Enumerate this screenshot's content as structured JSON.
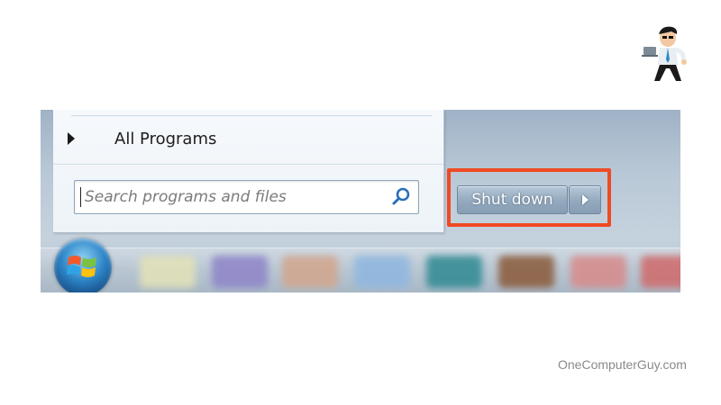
{
  "start_menu": {
    "all_programs": "All Programs",
    "search_placeholder": "Search programs and files",
    "shutdown_label": "Shut down"
  },
  "icons": {
    "all_programs_arrow": "triangle-right-icon",
    "search": "magnifier-icon",
    "shutdown_options": "triangle-right-icon",
    "start_button": "windows-logo-icon"
  },
  "colors": {
    "highlight": "#ef4a24",
    "search_icon": "#2a6fb8",
    "taskbar": "#b8c6d3"
  },
  "watermark": "OneComputerGuy.com"
}
